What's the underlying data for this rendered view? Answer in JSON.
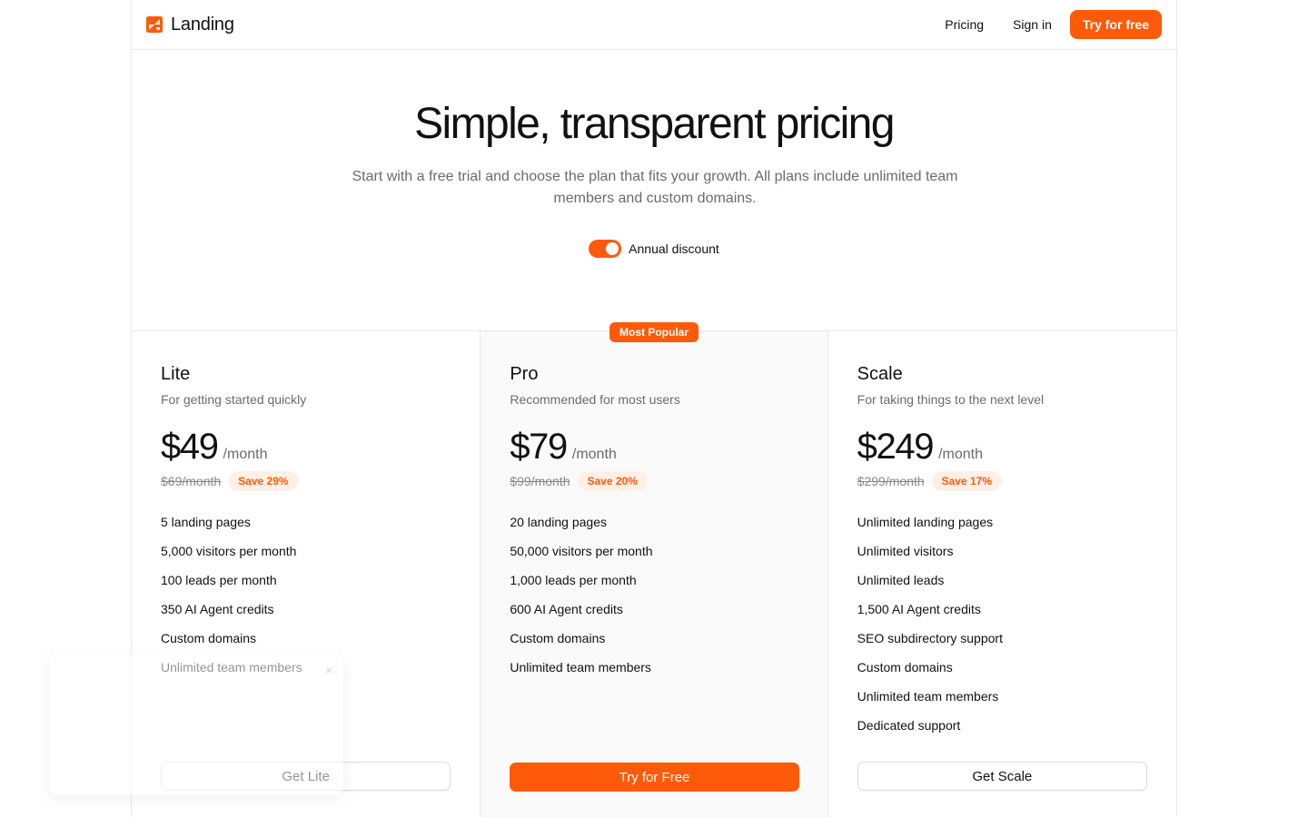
{
  "header": {
    "brand": "Landing",
    "nav": [
      "Pricing",
      "Sign in"
    ],
    "cta": "Try for free"
  },
  "hero": {
    "title": "Simple, transparent pricing",
    "subtitle": "Start with a free trial and choose the plan that fits your growth. All plans include unlimited team members and custom domains.",
    "toggle_label": "Annual discount",
    "toggle_on": true
  },
  "plans": [
    {
      "name": "Lite",
      "description": "For getting started quickly",
      "price": "$49",
      "period": "/month",
      "old_price": "$69/month",
      "save": "Save 29%",
      "features": [
        "5 landing pages",
        "5,000 visitors per month",
        "100 leads per month",
        "350 AI Agent credits",
        "Custom domains",
        "Unlimited team members"
      ],
      "button": "Get Lite"
    },
    {
      "name": "Pro",
      "badge": "Most Popular",
      "description": "Recommended for most users",
      "price": "$79",
      "period": "/month",
      "old_price": "$99/month",
      "save": "Save 20%",
      "features": [
        "20 landing pages",
        "50,000 visitors per month",
        "1,000 leads per month",
        "600 AI Agent credits",
        "Custom domains",
        "Unlimited team members"
      ],
      "button": "Try for Free"
    },
    {
      "name": "Scale",
      "description": "For taking things to the next level",
      "price": "$249",
      "period": "/month",
      "old_price": "$299/month",
      "save": "Save 17%",
      "features": [
        "Unlimited landing pages",
        "Unlimited visitors",
        "Unlimited leads",
        "1,500 AI Agent credits",
        "SEO subdirectory support",
        "Custom domains",
        "Unlimited team members",
        "Dedicated support"
      ],
      "button": "Get Scale"
    }
  ],
  "toast": {
    "close_icon": "×"
  },
  "colors": {
    "accent": "#ff5a0a",
    "accent_soft": "#fff0e7",
    "muted_text": "#6b6b6b",
    "border": "#e8e8e8"
  },
  "icons": {
    "logo": "landing-logo-icon",
    "close": "close-icon"
  }
}
